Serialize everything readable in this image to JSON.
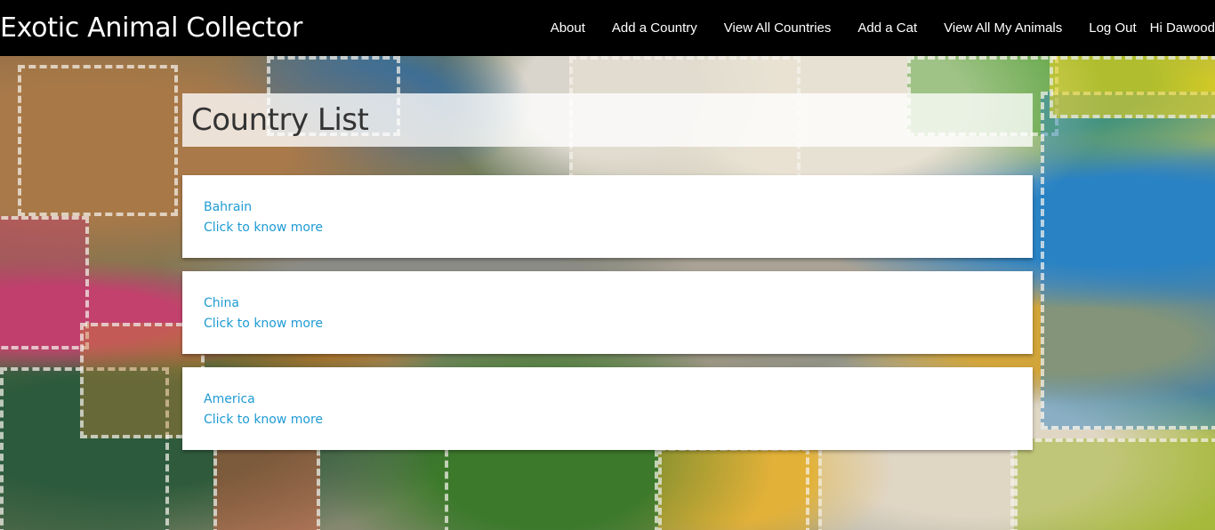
{
  "navbar": {
    "brand": "Exotic Animal Collector",
    "links": [
      {
        "label": "About"
      },
      {
        "label": "Add a Country"
      },
      {
        "label": "View All Countries"
      },
      {
        "label": "Add a Cat"
      },
      {
        "label": "View All My Animals"
      },
      {
        "label": "Log Out"
      }
    ],
    "greeting": "Hi Dawood"
  },
  "main": {
    "title": "Country List",
    "countries": [
      {
        "name": "Bahrain",
        "more": "Click to know more"
      },
      {
        "name": "China",
        "more": "Click to know more"
      },
      {
        "name": "America",
        "more": "Click to know more"
      }
    ]
  },
  "colors": {
    "navbar_bg": "#000000",
    "link": "#1e9bd4",
    "title_text": "#333333"
  }
}
